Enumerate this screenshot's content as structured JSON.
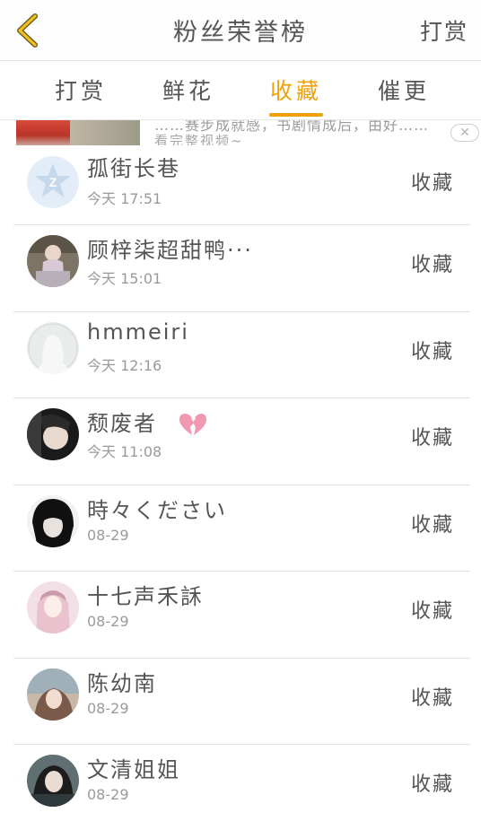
{
  "header": {
    "title": "粉丝荣誉榜",
    "action_label": "打赏"
  },
  "tabs": [
    {
      "label": "打赏",
      "active": false
    },
    {
      "label": "鲜花",
      "active": false
    },
    {
      "label": "收藏",
      "active": true
    },
    {
      "label": "催更",
      "active": false
    }
  ],
  "ad": {
    "headline": "……赛步成就感，书剧情成后，由好……",
    "subline": "看完整视频~",
    "close_label": "✕"
  },
  "colors": {
    "accent": "#f0a10a",
    "text": "#555555",
    "muted": "#9a9a9a",
    "divider": "#e1e1e1"
  },
  "list": [
    {
      "name": "孤街长巷",
      "time": "今天 17:51",
      "action": "收藏",
      "avatar": "qq-default-avatar"
    },
    {
      "name": "顾梓柒超甜鸭···",
      "time": "今天 15:01",
      "action": "收藏",
      "avatar": "photo-avatar"
    },
    {
      "name": "hmmeiri",
      "time": "今天 12:16",
      "action": "收藏",
      "avatar": "placeholder-avatar"
    },
    {
      "name": "颓废者",
      "time": "今天 11:08",
      "action": "收藏",
      "avatar": "photo-avatar",
      "badge": "broken-heart-icon"
    },
    {
      "name": "時々ください",
      "time": "08-29",
      "action": "收藏",
      "avatar": "photo-avatar"
    },
    {
      "name": "十七声禾訸",
      "time": "08-29",
      "action": "收藏",
      "avatar": "photo-avatar"
    },
    {
      "name": "陈幼南",
      "time": "08-29",
      "action": "收藏",
      "avatar": "photo-avatar"
    },
    {
      "name": "文清姐姐",
      "time": "08-29",
      "action": "收藏",
      "avatar": "photo-avatar"
    }
  ]
}
